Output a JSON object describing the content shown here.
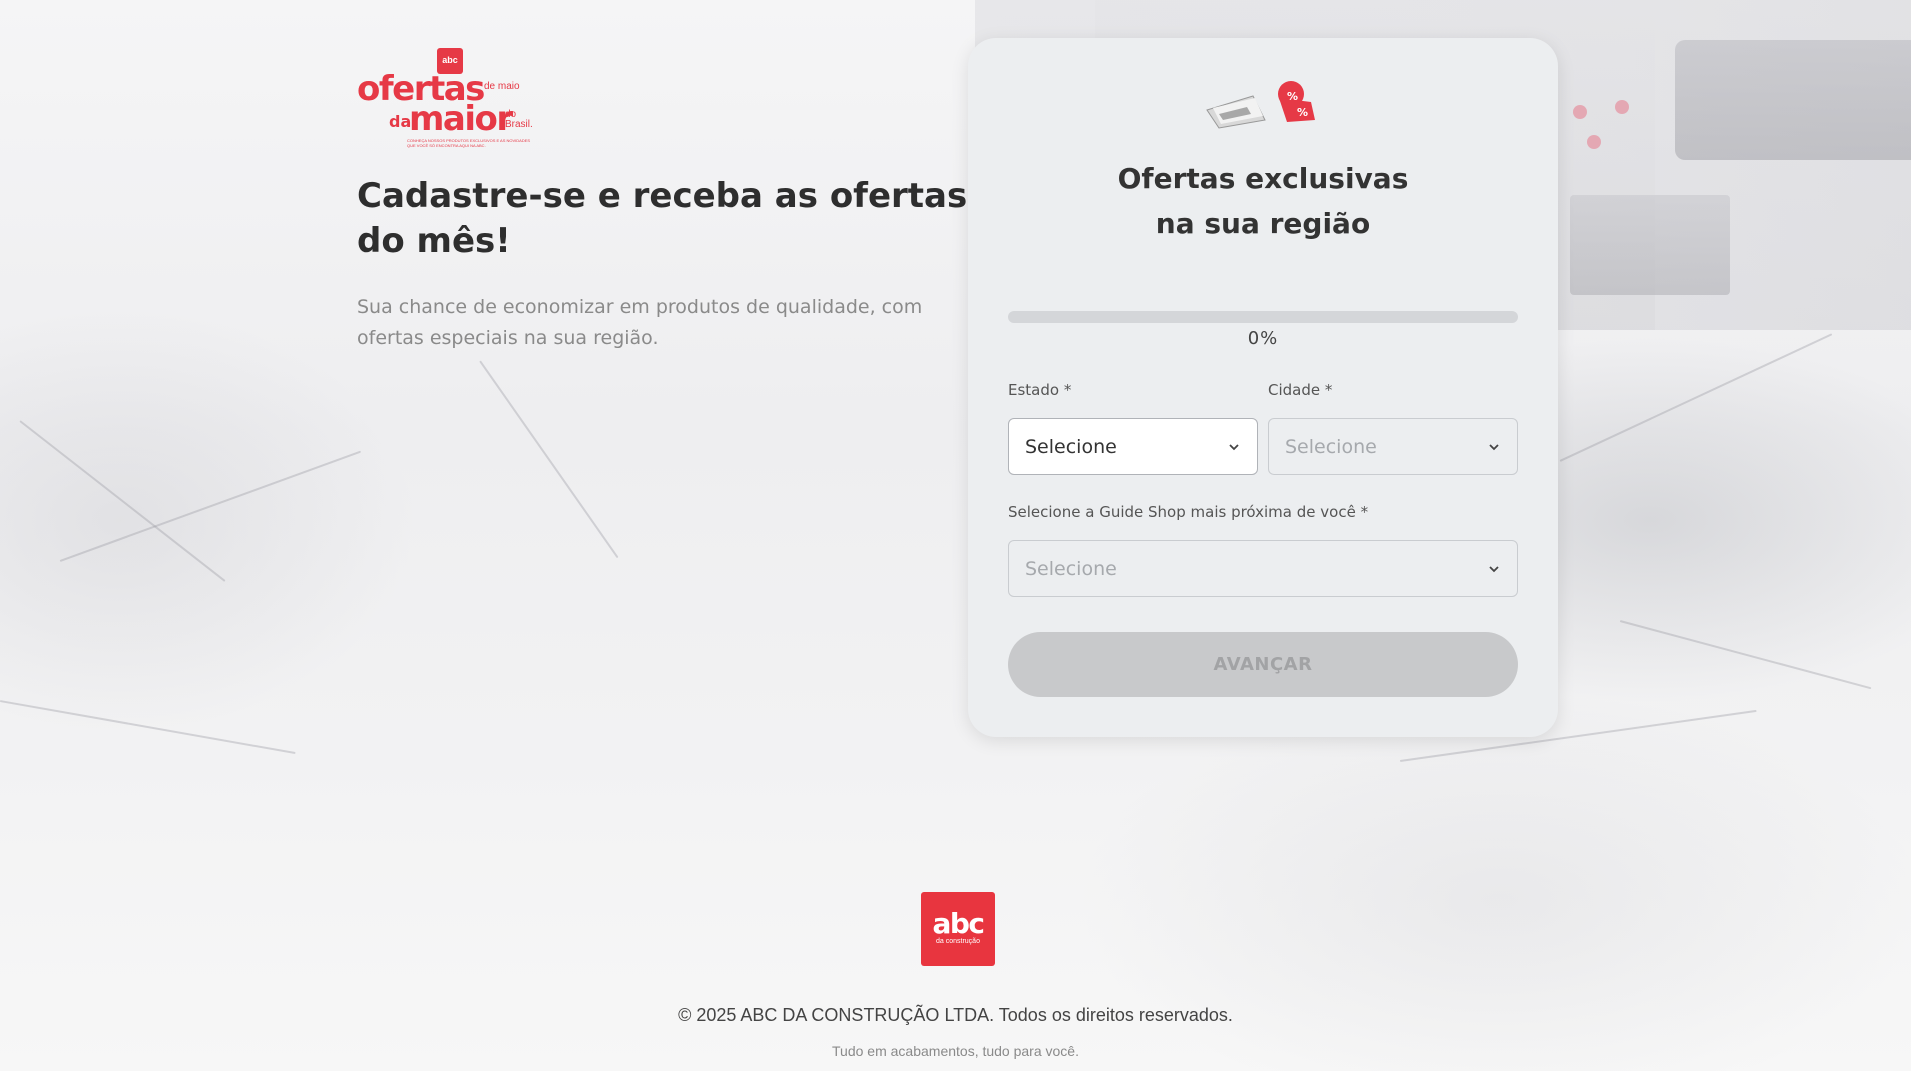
{
  "colors": {
    "brand_red": "#e63946",
    "card_bg": "#eceef0",
    "button_disabled": "#c8c9cb"
  },
  "brand": {
    "badge": "abc",
    "line1": "ofertas",
    "line1_small": "de maio",
    "line2_pre": "da",
    "line2": "maior",
    "line2_small": "do Brasil.",
    "tagline": "Conheça nossos produtos exclusivos e as novidades que você só encontra aqui na ABC."
  },
  "hero": {
    "title": "Cadastre-se e receba as ofertas do mês!",
    "subtitle": "Sua chance de economizar em produtos de qualidade, com ofertas especiais na sua região."
  },
  "card": {
    "illustration_icon": "catalog-discount-icon",
    "title_line1": "Ofertas exclusivas",
    "title_line2": "na sua região",
    "progress": {
      "value": 0,
      "label": "0%"
    },
    "fields": {
      "estado": {
        "label": "Estado *",
        "value": "Selecione"
      },
      "cidade": {
        "label": "Cidade *",
        "placeholder": "Selecione"
      },
      "guide_shop": {
        "label": "Selecione a Guide Shop mais próxima de você *",
        "placeholder": "Selecione"
      }
    },
    "button": "AVANÇAR"
  },
  "footer": {
    "logo_main": "abc",
    "logo_sub": "da construção",
    "copyright": "© 2025 ABC DA CONSTRUÇÃO LTDA. Todos os direitos reservados.",
    "tagline": "Tudo em acabamentos, tudo para você."
  }
}
